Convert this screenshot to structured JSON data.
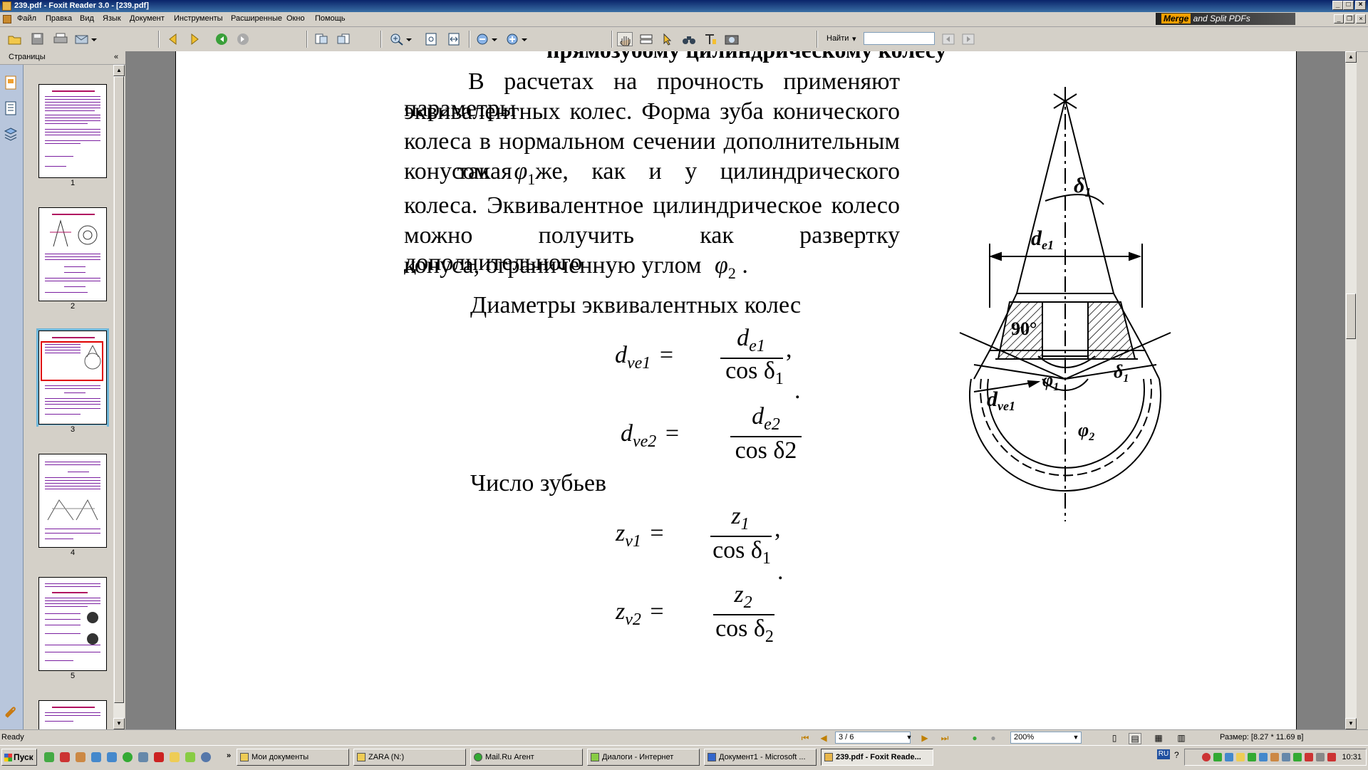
{
  "window": {
    "title": "239.pdf - Foxit Reader 3.0 - [239.pdf]"
  },
  "menu": [
    "Файл",
    "Правка",
    "Вид",
    "Язык",
    "Документ",
    "Инструменты",
    "Расширенные",
    "Окно",
    "Помощь"
  ],
  "ad": {
    "brand": "Merge",
    "rest": " and Split PDFs"
  },
  "toolbar": {
    "find_label": "Найти",
    "find_value": ""
  },
  "leftpane": {
    "title": "Страницы",
    "collapse": "«"
  },
  "thumbnails": [
    {
      "num": "1",
      "selected": false
    },
    {
      "num": "2",
      "selected": false
    },
    {
      "num": "3",
      "selected": true
    },
    {
      "num": "4",
      "selected": false
    },
    {
      "num": "5",
      "selected": false
    }
  ],
  "document": {
    "heading_partial": "прямозубому цилиндрическому колесу",
    "para1_lines": [
      "В расчетах на прочность применяют параметры",
      "эквивалентных колес. Форма зуба конического",
      "колеса в нормальном сечении дополнительным",
      "колеса. Эквивалентное цилиндрическое колесо",
      "можно получить как развертку дополнительного"
    ],
    "para1_line4_a": "конусом",
    "para1_line4_b": "такая же, как и у цилиндрического",
    "para1_line7": "конуса, ограниченную углом",
    "diam_heading": "Диаметры эквивалентных колес",
    "teeth_heading": "Число зубьев",
    "phi1": "φ",
    "phi1_sub": "1",
    "phi2": "φ",
    "phi2_sub": "2",
    "formula_dve1": {
      "lhs": "d",
      "lhs_sub": "ve1",
      "num": "d",
      "num_sub": "e1",
      "den": "cos δ",
      "den_sub": "1",
      "tail": ","
    },
    "formula_dve2": {
      "lhs": "d",
      "lhs_sub": "ve2",
      "num": "d",
      "num_sub": "e2",
      "den": "cos δ2",
      "den_sub": ""
    },
    "formula_zv1": {
      "lhs": "z",
      "lhs_sub": "v1",
      "num": "z",
      "num_sub": "1",
      "den": "cos δ",
      "den_sub": "1",
      "tail": ","
    },
    "formula_zv2": {
      "lhs": "z",
      "lhs_sub": "v2",
      "num": "z",
      "num_sub": "2",
      "den": "cos δ",
      "den_sub": "2"
    },
    "dot": ".",
    "figure_labels": {
      "delta1": "δ",
      "delta1_sub": "1",
      "de1": "d",
      "de1_sub": "e1",
      "angle90": "90°",
      "phi1": "φ",
      "phi1_sub": "1",
      "delta1b": "δ",
      "delta1b_sub": "1",
      "dve1": "d",
      "dve1_sub": "ve1",
      "phi2": "φ",
      "phi2_sub": "2"
    }
  },
  "status": {
    "ready": "Ready",
    "page": "3 / 6",
    "zoom": "200%",
    "size": "Размер: [8.27 * 11.69 в]"
  },
  "taskbar": {
    "start": "Пуск",
    "tasks": [
      {
        "label": "Мои документы",
        "active": false
      },
      {
        "label": "ZARA (N:)",
        "active": false
      },
      {
        "label": "Mail.Ru Агент",
        "active": false
      },
      {
        "label": "Диалоги - Интернет",
        "active": false
      },
      {
        "label": "Документ1 - Microsoft ...",
        "active": false
      },
      {
        "label": "239.pdf - Foxit Reade...",
        "active": true
      }
    ],
    "lang": "RU",
    "clock": "10:31"
  }
}
